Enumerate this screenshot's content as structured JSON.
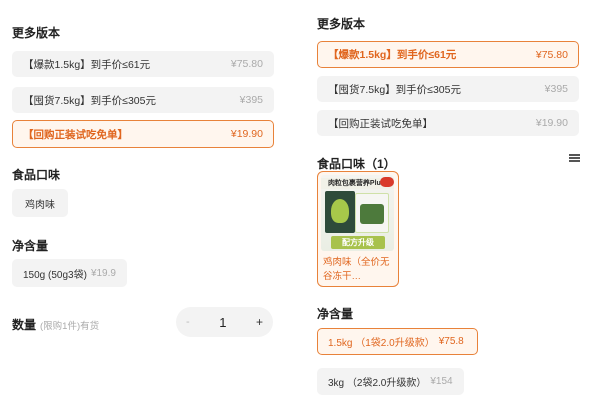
{
  "left": {
    "versions_title": "更多版本",
    "versions": [
      {
        "label": "【爆款1.5kg】到手价≤61元",
        "price": "¥75.80",
        "selected": false
      },
      {
        "label": "【囤货7.5kg】到手价≤305元",
        "price": "¥395",
        "selected": false
      },
      {
        "label": "【回购正装试吃免单】",
        "price": "¥19.90",
        "selected": true
      }
    ],
    "flavor_title": "食品口味",
    "flavor_chip": "鸡肉味",
    "net_title": "净含量",
    "net_chip_label": "150g (50g3袋)",
    "net_chip_price": "¥19.9",
    "qty_label": "数量",
    "qty_note": "(限购1件)有货",
    "qty_minus": "-",
    "qty_value": "1",
    "qty_plus": "+"
  },
  "right": {
    "versions_title": "更多版本",
    "versions": [
      {
        "label": "【爆款1.5kg】到手价≤61元",
        "price": "¥75.80",
        "selected": true
      },
      {
        "label": "【囤货7.5kg】到手价≤305元",
        "price": "¥395",
        "selected": false
      },
      {
        "label": "【回购正装试吃免单】",
        "price": "¥19.90",
        "selected": false
      }
    ],
    "flavor_title": "食品口味（1）",
    "flavor_card": {
      "header": "肉粒包裹营养Plus!",
      "banner": "配方升级",
      "label": "鸡肉味（全价无谷冻干…"
    },
    "net_title": "净含量",
    "net_options": [
      {
        "label": "1.5kg （1袋2.0升级款）",
        "price": "¥75.8",
        "selected": true
      },
      {
        "label": "3kg （2袋2.0升级款）",
        "price": "¥154",
        "selected": false
      }
    ]
  },
  "colors": {
    "accent": "#e0661f",
    "accent_border": "#e8823a",
    "selected_bg": "#fff6ee",
    "chip_bg": "#f3f3f3",
    "muted_text": "#aaaaaa"
  },
  "icons": {
    "drag_handle": "list-icon"
  }
}
